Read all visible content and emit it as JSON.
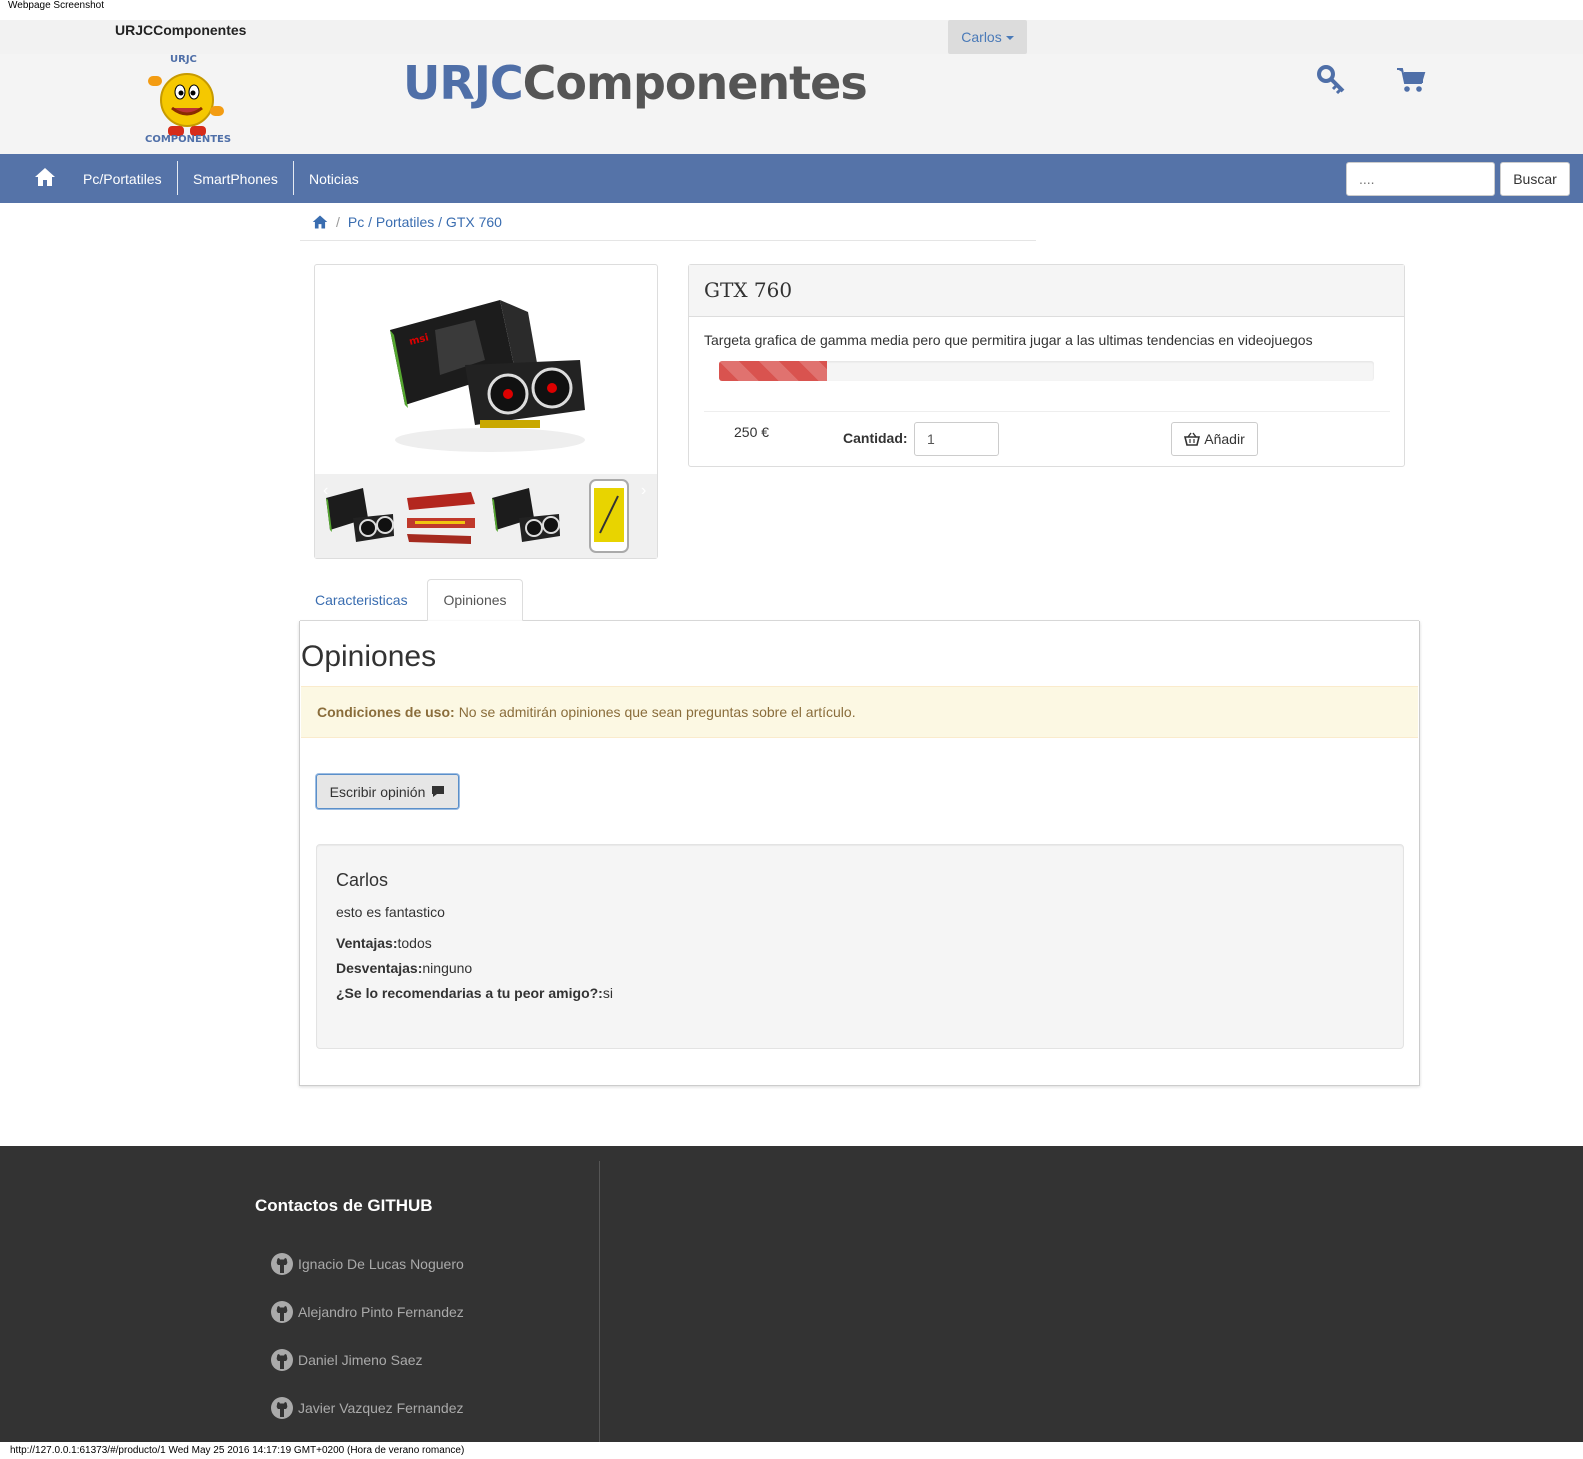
{
  "screenshot_caption": "Webpage Screenshot",
  "topbar": {
    "brand": "URJCComponentes",
    "user_label": "Carlos"
  },
  "header": {
    "logo_title_part1": "URJC",
    "logo_title_part2": "Componentes",
    "logo_caption_top": "URJC",
    "logo_caption_bottom": "COMPONENTES",
    "icons": [
      "key-icon",
      "cart-icon"
    ]
  },
  "nav": {
    "items": [
      {
        "label": "Pc/Portatiles"
      },
      {
        "label": "SmartPhones"
      },
      {
        "label": "Noticias"
      }
    ],
    "search_placeholder": "....",
    "search_button": "Buscar",
    "background_color": "#5573a8"
  },
  "breadcrumb": {
    "icon": "home-icon",
    "trail": "Pc / Portatiles / GTX 760"
  },
  "product": {
    "title": "GTX 760",
    "description": "Targeta grafica de gamma media pero que permitira jugar a las ultimas tendencias en videojuegos",
    "rating_fraction": 0.165,
    "rating_color": "#d9534f",
    "price": "250 €",
    "quantity_label": "Cantidad:",
    "quantity_value": "1",
    "add_button": "Añadir"
  },
  "gallery": {
    "main_image": "graphics-card-box-image",
    "prev_arrow": "‹",
    "next_arrow": "›",
    "thumbnails": [
      "graphics-card",
      "ram-memory",
      "graphics-card",
      "smartphone"
    ]
  },
  "tabs": [
    {
      "label": "Caracteristicas",
      "active": false
    },
    {
      "label": "Opiniones",
      "active": true
    }
  ],
  "opinions": {
    "title": "Opiniones",
    "alert_bold": "Condiciones de uso:",
    "alert_text": "No se admitirán opiniones que sean preguntas sobre el artículo.",
    "write_button": "Escribir opinión",
    "reviews": [
      {
        "author": "Carlos",
        "text": "esto es fantastico",
        "pros_label": "Ventajas:",
        "pros": "todos",
        "cons_label": "Desventajas:",
        "cons": "ninguno",
        "recommend_label": "¿Se lo recomendarias a tu peor amigo?:",
        "recommend": "si"
      }
    ]
  },
  "footer": {
    "heading": "Contactos de GITHUB",
    "contacts": [
      "Ignacio De Lucas Noguero",
      "Alejandro Pinto Fernandez",
      "Daniel Jimeno Saez",
      "Javier Vazquez Fernandez"
    ]
  },
  "status_bar": "http://127.0.0.1:61373/#/producto/1 Wed May 25 2016 14:17:19 GMT+0200 (Hora de verano romance)"
}
